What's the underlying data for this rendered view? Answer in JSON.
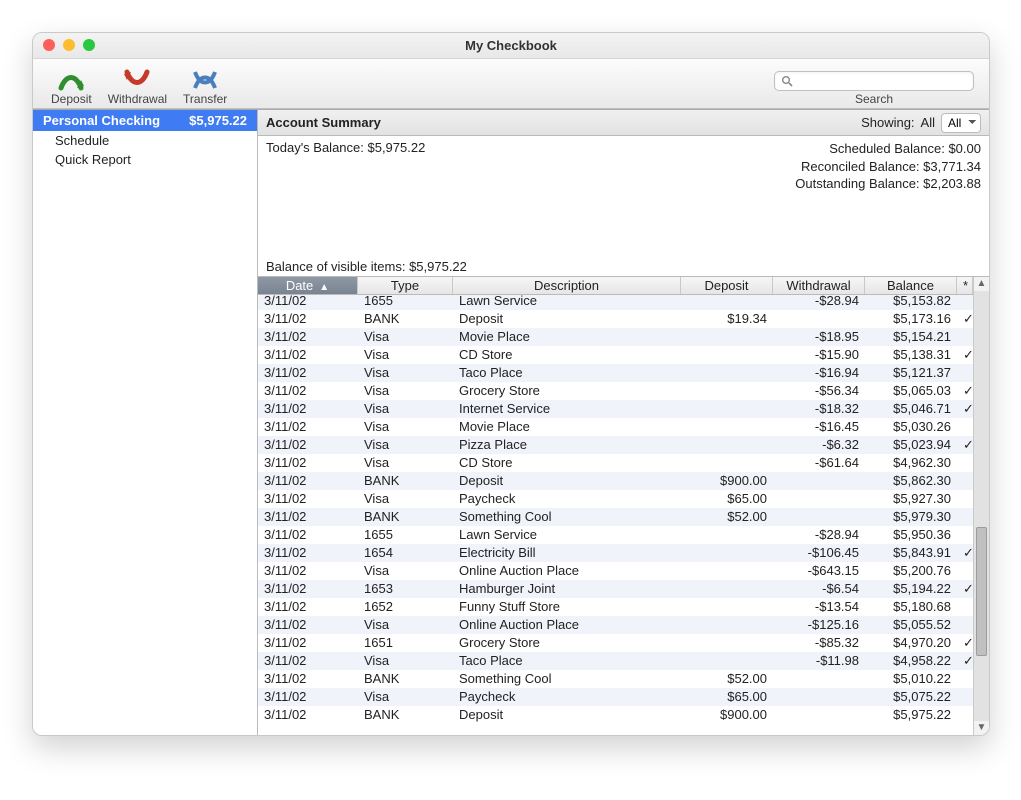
{
  "window": {
    "title": "My Checkbook"
  },
  "toolbar": {
    "deposit": "Deposit",
    "withdrawal": "Withdrawal",
    "transfer": "Transfer",
    "search_label": "Search",
    "search_placeholder": ""
  },
  "sidebar": {
    "account_name": "Personal Checking",
    "account_balance": "$5,975.22",
    "schedule": "Schedule",
    "quick_report": "Quick Report"
  },
  "summary": {
    "title": "Account Summary",
    "showing_label": "Showing:",
    "showing_value": "All",
    "filter_option": "All",
    "today_balance": "Today's Balance: $5,975.22",
    "scheduled_balance": "Scheduled Balance: $0.00",
    "reconciled_balance": "Reconciled Balance: $3,771.34",
    "outstanding_balance": "Outstanding Balance: $2,203.88",
    "visible_balance": "Balance of visible items: $5,975.22"
  },
  "columns": {
    "date": "Date",
    "type": "Type",
    "desc": "Description",
    "deposit": "Deposit",
    "withdrawal": "Withdrawal",
    "balance": "Balance",
    "chk": "*"
  },
  "rows": [
    {
      "date": "3/11/02",
      "type": "1655",
      "desc": "Lawn Service",
      "dep": "",
      "wd": "-$28.94",
      "bal": "$5,153.82",
      "chk": ""
    },
    {
      "date": "3/11/02",
      "type": "BANK",
      "desc": "Deposit",
      "dep": "$19.34",
      "wd": "",
      "bal": "$5,173.16",
      "chk": "✓"
    },
    {
      "date": "3/11/02",
      "type": "Visa",
      "desc": "Movie Place",
      "dep": "",
      "wd": "-$18.95",
      "bal": "$5,154.21",
      "chk": ""
    },
    {
      "date": "3/11/02",
      "type": "Visa",
      "desc": "CD Store",
      "dep": "",
      "wd": "-$15.90",
      "bal": "$5,138.31",
      "chk": "✓"
    },
    {
      "date": "3/11/02",
      "type": "Visa",
      "desc": "Taco Place",
      "dep": "",
      "wd": "-$16.94",
      "bal": "$5,121.37",
      "chk": ""
    },
    {
      "date": "3/11/02",
      "type": "Visa",
      "desc": "Grocery Store",
      "dep": "",
      "wd": "-$56.34",
      "bal": "$5,065.03",
      "chk": "✓"
    },
    {
      "date": "3/11/02",
      "type": "Visa",
      "desc": "Internet Service",
      "dep": "",
      "wd": "-$18.32",
      "bal": "$5,046.71",
      "chk": "✓"
    },
    {
      "date": "3/11/02",
      "type": "Visa",
      "desc": "Movie Place",
      "dep": "",
      "wd": "-$16.45",
      "bal": "$5,030.26",
      "chk": ""
    },
    {
      "date": "3/11/02",
      "type": "Visa",
      "desc": "Pizza Place",
      "dep": "",
      "wd": "-$6.32",
      "bal": "$5,023.94",
      "chk": "✓"
    },
    {
      "date": "3/11/02",
      "type": "Visa",
      "desc": "CD Store",
      "dep": "",
      "wd": "-$61.64",
      "bal": "$4,962.30",
      "chk": ""
    },
    {
      "date": "3/11/02",
      "type": "BANK",
      "desc": "Deposit",
      "dep": "$900.00",
      "wd": "",
      "bal": "$5,862.30",
      "chk": ""
    },
    {
      "date": "3/11/02",
      "type": "Visa",
      "desc": "Paycheck",
      "dep": "$65.00",
      "wd": "",
      "bal": "$5,927.30",
      "chk": ""
    },
    {
      "date": "3/11/02",
      "type": "BANK",
      "desc": "Something Cool",
      "dep": "$52.00",
      "wd": "",
      "bal": "$5,979.30",
      "chk": ""
    },
    {
      "date": "3/11/02",
      "type": "1655",
      "desc": "Lawn Service",
      "dep": "",
      "wd": "-$28.94",
      "bal": "$5,950.36",
      "chk": ""
    },
    {
      "date": "3/11/02",
      "type": "1654",
      "desc": "Electricity Bill",
      "dep": "",
      "wd": "-$106.45",
      "bal": "$5,843.91",
      "chk": "✓"
    },
    {
      "date": "3/11/02",
      "type": "Visa",
      "desc": "Online Auction Place",
      "dep": "",
      "wd": "-$643.15",
      "bal": "$5,200.76",
      "chk": ""
    },
    {
      "date": "3/11/02",
      "type": "1653",
      "desc": "Hamburger Joint",
      "dep": "",
      "wd": "-$6.54",
      "bal": "$5,194.22",
      "chk": "✓"
    },
    {
      "date": "3/11/02",
      "type": "1652",
      "desc": "Funny Stuff Store",
      "dep": "",
      "wd": "-$13.54",
      "bal": "$5,180.68",
      "chk": ""
    },
    {
      "date": "3/11/02",
      "type": "Visa",
      "desc": "Online Auction Place",
      "dep": "",
      "wd": "-$125.16",
      "bal": "$5,055.52",
      "chk": ""
    },
    {
      "date": "3/11/02",
      "type": "1651",
      "desc": "Grocery Store",
      "dep": "",
      "wd": "-$85.32",
      "bal": "$4,970.20",
      "chk": "✓"
    },
    {
      "date": "3/11/02",
      "type": "Visa",
      "desc": "Taco Place",
      "dep": "",
      "wd": "-$11.98",
      "bal": "$4,958.22",
      "chk": "✓"
    },
    {
      "date": "3/11/02",
      "type": "BANK",
      "desc": "Something Cool",
      "dep": "$52.00",
      "wd": "",
      "bal": "$5,010.22",
      "chk": ""
    },
    {
      "date": "3/11/02",
      "type": "Visa",
      "desc": "Paycheck",
      "dep": "$65.00",
      "wd": "",
      "bal": "$5,075.22",
      "chk": ""
    },
    {
      "date": "3/11/02",
      "type": "BANK",
      "desc": "Deposit",
      "dep": "$900.00",
      "wd": "",
      "bal": "$5,975.22",
      "chk": ""
    }
  ]
}
